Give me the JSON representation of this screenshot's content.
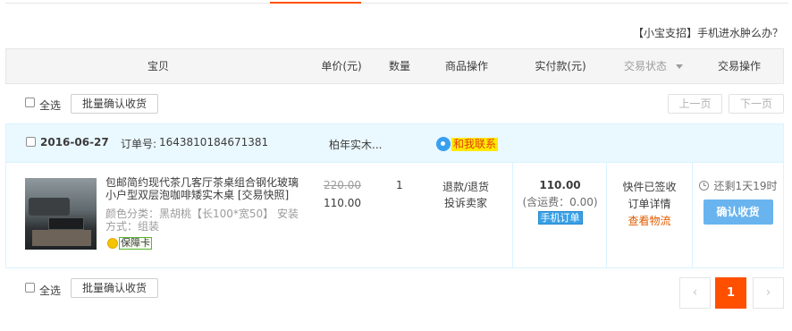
{
  "tip": {
    "text": "【小宝支招】手机进水肿么办？"
  },
  "header": {
    "columns": {
      "item": "宝贝",
      "unit_price": "单价(元)",
      "quantity": "数量",
      "item_actions": "商品操作",
      "paid": "实付款(元)",
      "status": "交易状态",
      "trade_actions": "交易操作"
    }
  },
  "bulk_top": {
    "select_all": "全选",
    "batch_confirm": "批量确认收货",
    "prev_page": "上一页",
    "next_page": "下一页"
  },
  "order": {
    "date": "2016-06-27",
    "order_no_label": "订单号:",
    "order_no": "1643810184671381",
    "shop": "柏年实木...",
    "contact": "和我联系",
    "item": {
      "title": "包邮简约现代茶几客厅茶桌组合钢化玻璃小户型双层泡咖啡矮实木桌 [交易快照]",
      "sku": "颜色分类：黑胡桃【长100*宽50】 安装方式：组装",
      "guarantee": "保障卡",
      "original_price": "220.00",
      "price": "110.00",
      "quantity": "1"
    },
    "item_ops": {
      "refund": "退款/退货",
      "complain": "投诉卖家"
    },
    "payment": {
      "amount": "110.00",
      "shipping": "(含运费：0.00)",
      "mobile_order": "手机订单"
    },
    "status": {
      "signed": "快件已签收",
      "detail": "订单详情",
      "logistics": "查看物流"
    },
    "action": {
      "remaining": "还剩1天19时",
      "confirm": "确认收货"
    }
  },
  "bulk_bottom": {
    "select_all": "全选",
    "batch_confirm": "批量确认收货"
  },
  "pagination": {
    "prev": "‹",
    "current": "1",
    "next": "›"
  },
  "colors": {
    "accent": "#ff5000",
    "confirm_button": "#69b4ef",
    "order_header_bg": "#eaf8ff",
    "logistics_link": "#e05b00"
  }
}
